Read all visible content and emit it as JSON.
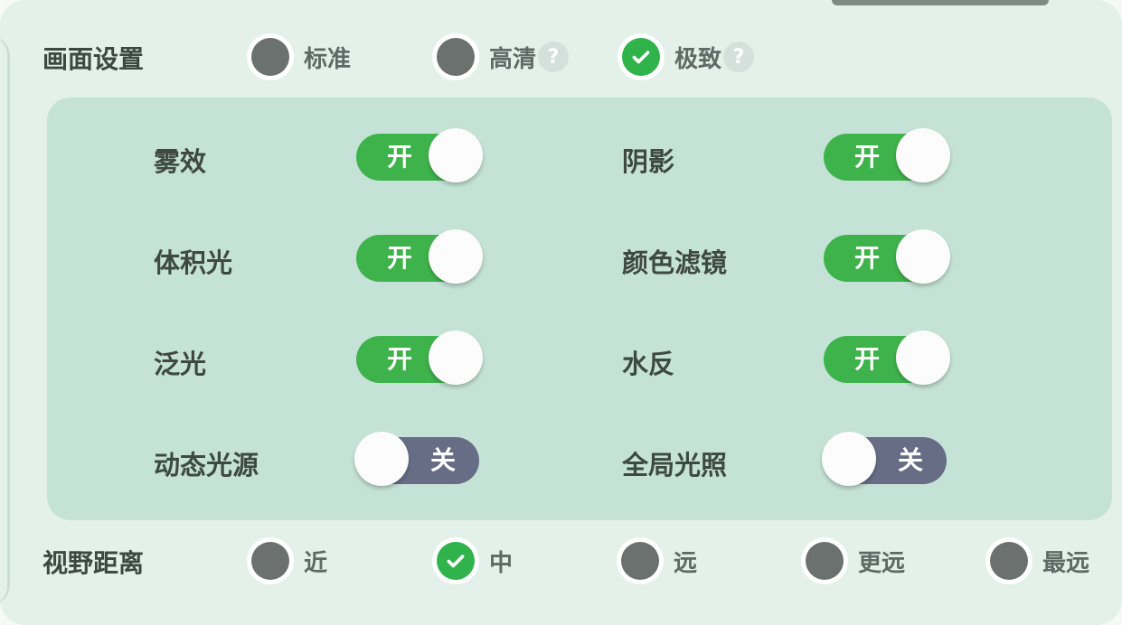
{
  "quality": {
    "title": "画面设置",
    "options": [
      {
        "label": "标准",
        "selected": false,
        "help": false
      },
      {
        "label": "高清",
        "selected": false,
        "help": true
      },
      {
        "label": "极致",
        "selected": true,
        "help": true
      }
    ],
    "help_glyph": "?"
  },
  "effects": [
    {
      "label": "雾效",
      "state": "开",
      "on": true
    },
    {
      "label": "阴影",
      "state": "开",
      "on": true
    },
    {
      "label": "体积光",
      "state": "开",
      "on": true
    },
    {
      "label": "颜色滤镜",
      "state": "开",
      "on": true
    },
    {
      "label": "泛光",
      "state": "开",
      "on": true
    },
    {
      "label": "水反",
      "state": "开",
      "on": true
    },
    {
      "label": "动态光源",
      "state": "关",
      "on": false
    },
    {
      "label": "全局光照",
      "state": "关",
      "on": false
    }
  ],
  "view_distance": {
    "title": "视野距离",
    "options": [
      {
        "label": "近",
        "selected": false
      },
      {
        "label": "中",
        "selected": true
      },
      {
        "label": "远",
        "selected": false
      },
      {
        "label": "更远",
        "selected": false
      },
      {
        "label": "最远",
        "selected": false
      }
    ]
  },
  "colors": {
    "accent_on": "#3fb34b",
    "toggle_off": "#666d84",
    "radio_unselected": "#6b716f"
  }
}
